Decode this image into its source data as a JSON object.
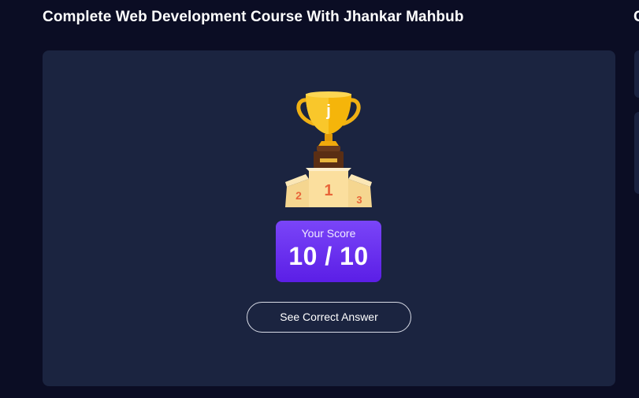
{
  "header": {
    "course_title": "Complete Web Development Course With Jhankar Mahbub",
    "next_section_initial": "C"
  },
  "result": {
    "trophy_letter": "j",
    "podium_first": "1",
    "podium_second": "2",
    "podium_third": "3",
    "score_label": "Your Score",
    "score_value": "10 / 10",
    "see_answer_label": "See Correct Answer"
  },
  "colors": {
    "page_background": "#0b0d24",
    "card_background": "#1b2440",
    "score_gradient_top": "#7a45f8",
    "score_gradient_bottom": "#5b1ee6",
    "trophy_gold": "#f5b50a"
  },
  "icons": {
    "trophy": "trophy-icon",
    "podium": "podium-icon"
  }
}
